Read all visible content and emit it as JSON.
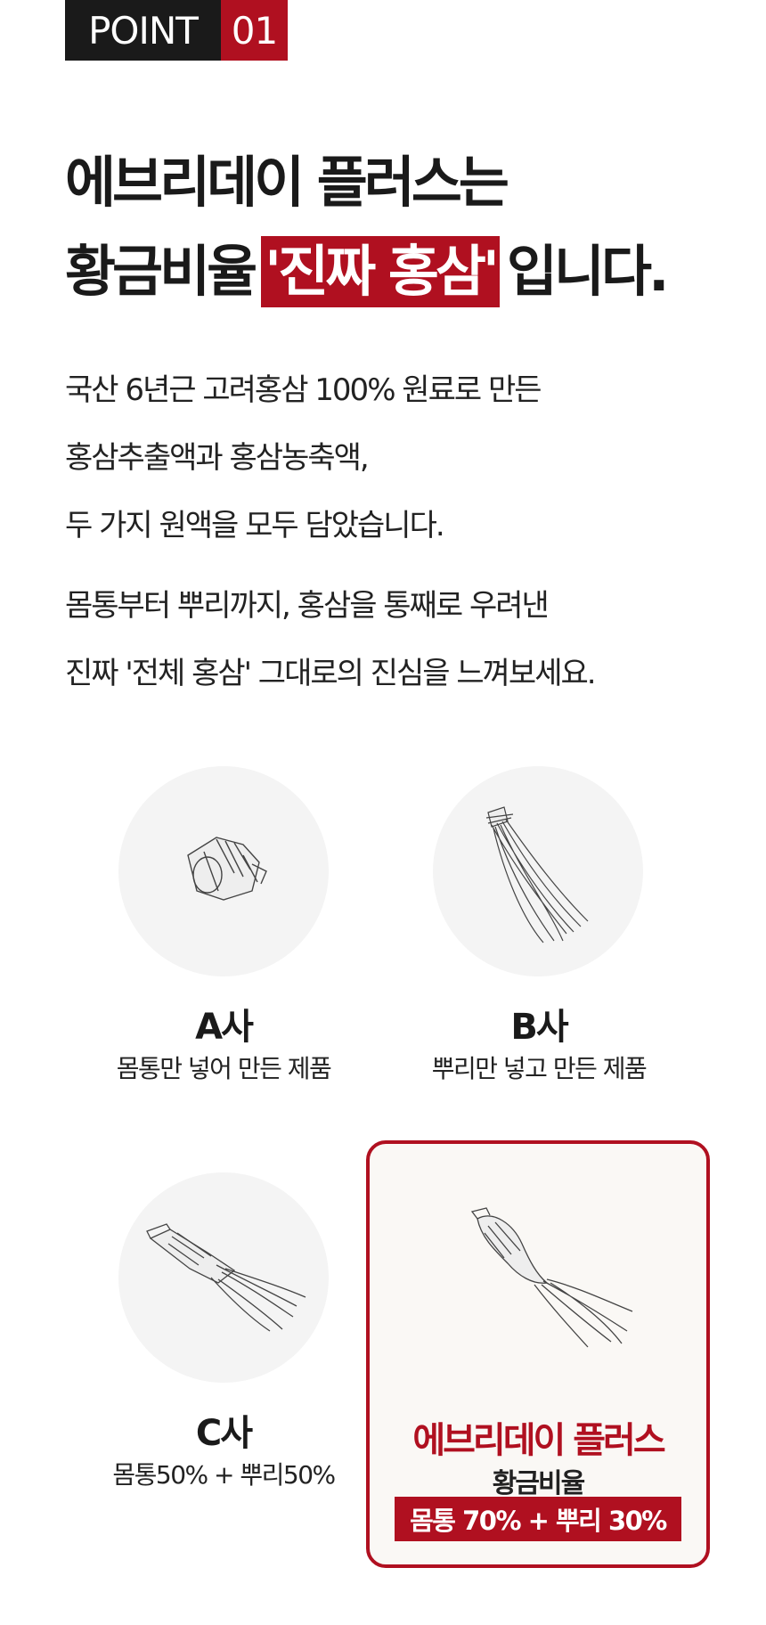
{
  "badge": {
    "label": "POINT",
    "number": "01"
  },
  "headline": {
    "line1": "에브리데이 플러스는",
    "line2_before": "황금비율",
    "line2_highlight": "'진짜 홍삼'",
    "line2_after": "입니다."
  },
  "description": {
    "para1": [
      "국산 6년근 고려홍삼 100% 원료로 만든",
      "홍삼추출액과 홍삼농축액,",
      "두 가지 원액을 모두 담았습니다."
    ],
    "para2": [
      "몸통부터 뿌리까지, 홍삼을 통째로 우려낸",
      "진짜 '전체 홍삼' 그대로의 진심을 느껴보세요."
    ]
  },
  "comparison": {
    "a": {
      "title": "A사",
      "subtitle": "몸통만 넣어 만든 제품",
      "icon": "ginseng-body-icon"
    },
    "b": {
      "title": "B사",
      "subtitle": "뿌리만 넣고 만든 제품",
      "icon": "ginseng-root-icon"
    },
    "c": {
      "title": "C사",
      "subtitle": "몸통50% + 뿌리50%",
      "icon": "ginseng-half-icon"
    },
    "ours": {
      "title": "에브리데이 플러스",
      "subtitle": "황금비율",
      "ratio": "몸통 70% + 뿌리 30%",
      "icon": "ginseng-whole-icon"
    }
  },
  "colors": {
    "accent": "#b01020",
    "dark": "#1a1a1a",
    "circle": "#f4f4f4",
    "card": "#faf8f5"
  }
}
